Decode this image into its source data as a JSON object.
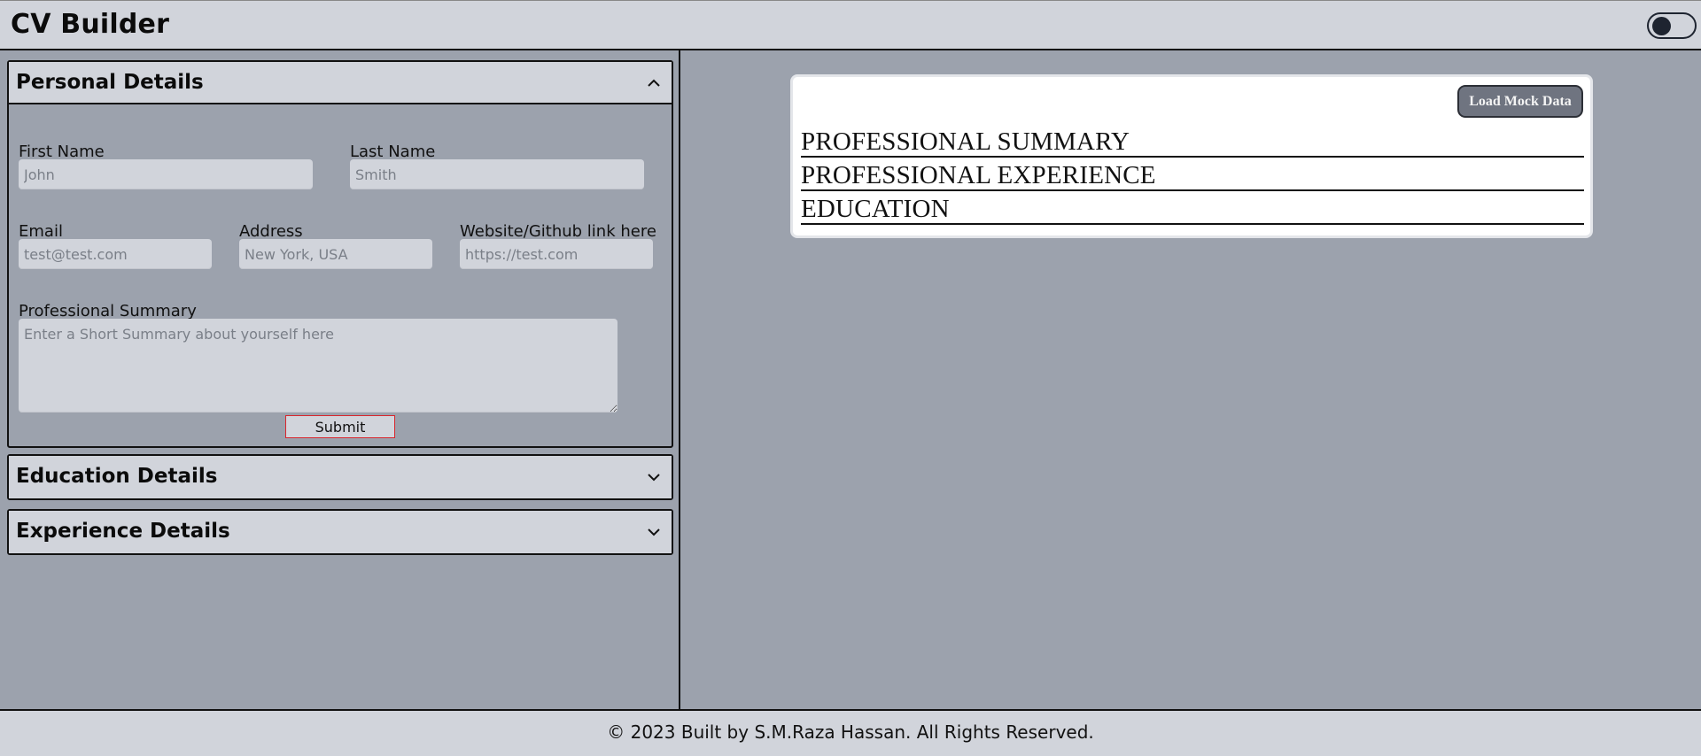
{
  "header": {
    "title": "CV Builder",
    "theme_toggle_state": "off"
  },
  "personal": {
    "title": "Personal Details",
    "first_name_label": "First Name",
    "first_name_placeholder": "John",
    "last_name_label": "Last Name",
    "last_name_placeholder": "Smith",
    "email_label": "Email",
    "email_placeholder": "test@test.com",
    "address_label": "Address",
    "address_placeholder": "New York, USA",
    "website_label": "Website/Github link here",
    "website_placeholder": "https://test.com",
    "summary_label": "Professional Summary",
    "summary_placeholder": "Enter a Short Summary about yourself here",
    "submit_label": "Submit"
  },
  "education": {
    "title": "Education Details"
  },
  "experience": {
    "title": "Experience Details"
  },
  "preview": {
    "mock_button": "Load Mock Data",
    "sections": [
      "PROFESSIONAL SUMMARY",
      "PROFESSIONAL EXPERIENCE",
      "EDUCATION"
    ]
  },
  "footer": {
    "text": "© 2023 Built by S.M.Raza Hassan. All Rights Reserved."
  },
  "colors": {
    "panel": "#d1d4db",
    "background": "#9ca2ad",
    "submit_border": "#d8262d",
    "mock_button": "#6f7480"
  },
  "icons": {
    "collapse": "chevron-up-icon",
    "expand": "chevron-down-icon"
  }
}
